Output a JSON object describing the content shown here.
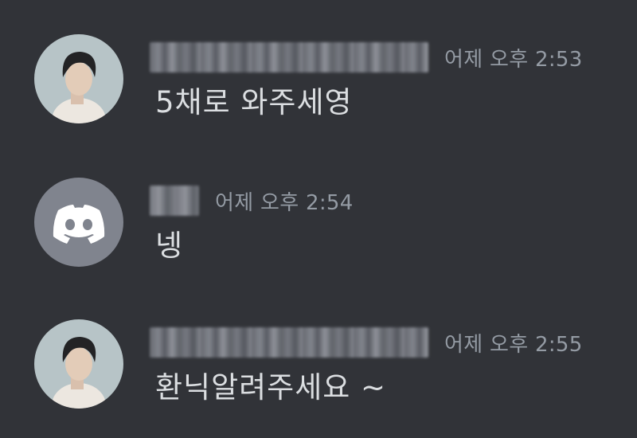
{
  "messages": [
    {
      "avatar": "user-avatar",
      "timestamp": "어제 오후 2:53",
      "content": "5채로 와주세영"
    },
    {
      "avatar": "discord-logo-icon",
      "timestamp": "어제 오후 2:54",
      "content": "넹"
    },
    {
      "avatar": "user-avatar",
      "timestamp": "어제 오후 2:55",
      "content": "환닉알려주세요 ~"
    }
  ],
  "colors": {
    "background": "#313338",
    "message_text": "#dbdee1",
    "timestamp_text": "#949ba4",
    "default_avatar": "#80848e"
  }
}
